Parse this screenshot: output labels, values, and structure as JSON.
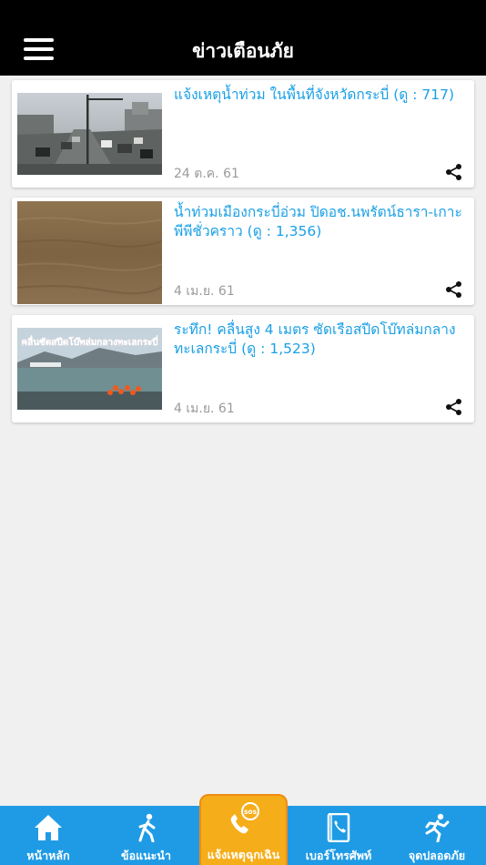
{
  "header": {
    "title": "ข่าวเตือนภัย",
    "menu_icon": "hamburger-menu-icon"
  },
  "news": [
    {
      "title": "แจ้งเหตุน้ำท่วม ในพื้นที่จังหวัดกระบี่ (ดู : 717)",
      "date": "24 ต.ค. 61",
      "image": "flooded-road-traffic-photo"
    },
    {
      "title": "น้ำท่วมเมืองกระบี่อ่วม ปิดอช.นพรัตน์ธารา-เกาะพีพีชั่วคราว (ดู : 1,356)",
      "date": "4 เม.ย. 61",
      "image": "muddy-floodwater-photo"
    },
    {
      "title": "ระทึก! คลื่นสูง 4 เมตร ซัดเรือสปีดโบ๊ทล่มกลางทะเลกระบี่ (ดู : 1,523)",
      "date": "4 เม.ย. 61",
      "image": "speedboat-capsized-rescue-photo",
      "image_caption": "คลื่นซัดสปีดโบ๊ทล่มกลางทะเลกระบี่"
    }
  ],
  "tabbar": {
    "home": "หน้าหลัก",
    "advice": "ข้อแนะนำ",
    "emergency": "แจ้งเหตุฉุกเฉิน",
    "emergency_badge": "sos",
    "phone": "เบอร์โทรศัพท์",
    "safe_point": "จุดปลอดภัย"
  },
  "colors": {
    "header_bg": "#000000",
    "title_blue": "#1aa0e6",
    "tabbar_blue": "#1f9be5",
    "emergency_orange": "#f5ad1a",
    "background": "#f0f0f0"
  }
}
